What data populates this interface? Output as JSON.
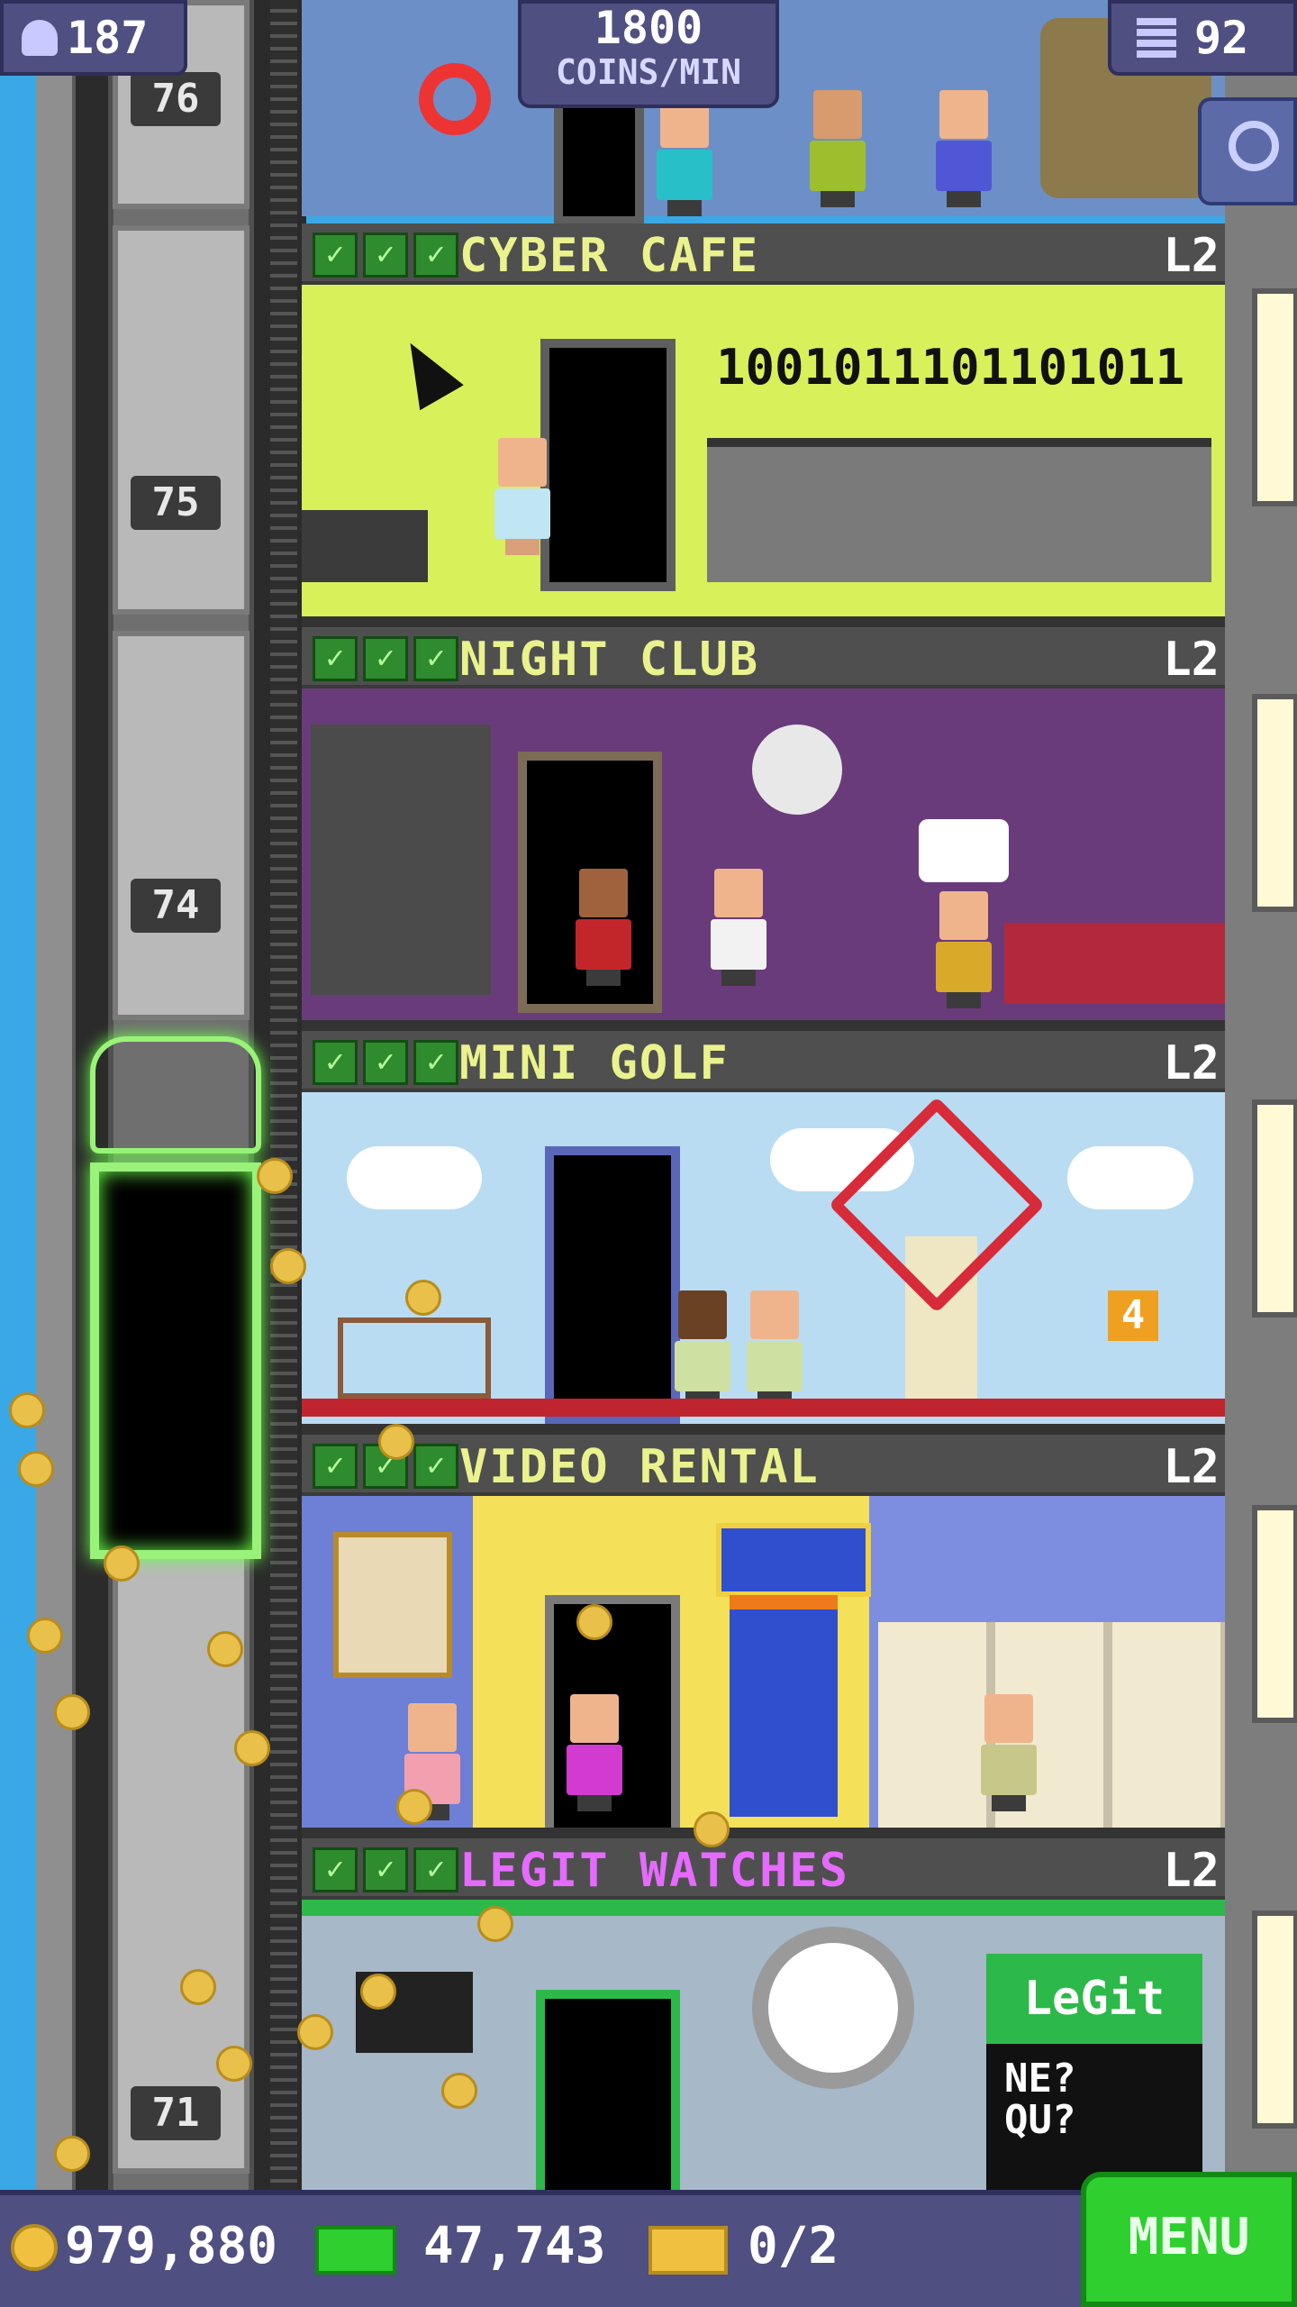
{
  "hud": {
    "population": "187",
    "coins_per_min_value": "1800",
    "coins_per_min_label": "COINS/MIN",
    "floor_count": "92"
  },
  "elevator": {
    "floor_numbers": [
      "76",
      "75",
      "74",
      "71"
    ]
  },
  "floors": [
    {
      "name": "CYBER CAFE",
      "level": "L2",
      "checks": 3,
      "room_text": "1001011101101011"
    },
    {
      "name": "NIGHT CLUB",
      "level": "L2",
      "checks": 3
    },
    {
      "name": "MINI GOLF",
      "level": "L2",
      "checks": 3,
      "hole_sign": "4"
    },
    {
      "name": "VIDEO RENTAL",
      "level": "L2",
      "checks": 3
    },
    {
      "name": "LEGIT WATCHES",
      "level": "L2",
      "checks": 3,
      "sign_text": "LeGit",
      "sign_sub": "NE?\nQU?"
    }
  ],
  "footer": {
    "coins": "979,880",
    "bux": "47,743",
    "tickets": "0/2",
    "menu_label": "MENU"
  },
  "colors": {
    "hud_bg": "#4f4f82",
    "menu_green": "#2ecf2e",
    "floor_name_yellow": "#eaf28d",
    "legit_name_pink": "#e56bff",
    "elevator_glow": "#9af27a"
  },
  "icons": [
    "population-icon",
    "floors-icon",
    "search-icon",
    "coin-icon",
    "bux-icon",
    "ticket-icon",
    "checkmark-icon"
  ]
}
